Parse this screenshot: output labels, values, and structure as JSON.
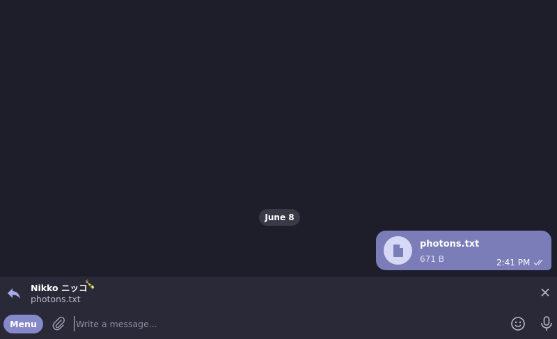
{
  "chat": {
    "date_label": "June 8",
    "message": {
      "file_name": "photons.txt",
      "file_size": "671 B",
      "time": "2:41 PM",
      "status_icon": "double-check-icon"
    }
  },
  "reply": {
    "author": "Nikko ニッコ",
    "author_emoji": "🍾",
    "text": "photons.txt"
  },
  "composer": {
    "menu_label": "Menu",
    "placeholder": "Write a message...",
    "value": ""
  },
  "colors": {
    "chat_bg": "#1e1d2a",
    "bubble_bg": "#7a7db8",
    "bottom_bg": "#2a2937",
    "accent": "#8689c9"
  }
}
